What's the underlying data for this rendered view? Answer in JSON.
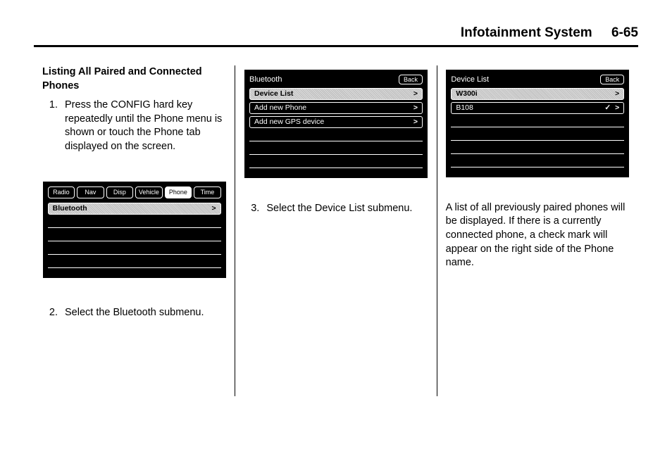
{
  "header": {
    "title": "Infotainment System",
    "page": "6-65"
  },
  "col1": {
    "section_title": "Listing All Paired and Connected Phones",
    "step1": "Press the CONFIG hard key repeatedly until the Phone menu is shown or touch the Phone tab displayed on the screen.",
    "step2": "Select the Bluetooth submenu."
  },
  "col2": {
    "step3": "Select the Device List submenu."
  },
  "col3": {
    "para": "A list of all previously paired phones will be displayed. If there is a currently connected phone, a check mark will appear on the right side of the Phone name."
  },
  "screen1": {
    "tabs": [
      "Radio",
      "Nav",
      "Disp",
      "Vehicle",
      "Phone",
      "Time"
    ],
    "selected_tab_index": 4,
    "rows": [
      {
        "label": "Bluetooth",
        "selected": true,
        "arrow": true
      }
    ],
    "empty_rows": 4
  },
  "screen2": {
    "title": "Bluetooth",
    "back": "Back",
    "rows": [
      {
        "label": "Device List",
        "selected": true,
        "arrow": true
      },
      {
        "label": "Add new Phone",
        "selected": false,
        "arrow": true
      },
      {
        "label": "Add new GPS device",
        "selected": false,
        "arrow": true
      }
    ],
    "empty_rows": 3
  },
  "screen3": {
    "title": "Device List",
    "back": "Back",
    "rows": [
      {
        "label": "W300i",
        "selected": true,
        "arrow": true,
        "check": false
      },
      {
        "label": "B108",
        "selected": false,
        "arrow": true,
        "check": true
      }
    ],
    "empty_rows": 4
  }
}
